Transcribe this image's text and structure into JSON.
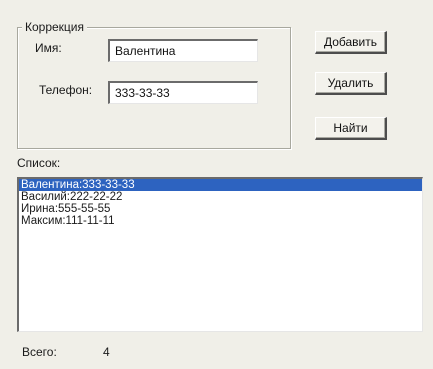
{
  "correction": {
    "title": "Коррекция",
    "name_label": "Имя:",
    "name_value": "Валентина",
    "phone_label": "Телефон:",
    "phone_value": "333-33-33"
  },
  "buttons": {
    "add": "Добавить",
    "delete": "Удалить",
    "find": "Найти"
  },
  "list": {
    "label": "Список:",
    "items": [
      {
        "text": "Валентина:333-33-33",
        "selected": true
      },
      {
        "text": "Василий:222-22-22",
        "selected": false
      },
      {
        "text": "Ирина:555-55-55",
        "selected": false
      },
      {
        "text": "Максим:111-11-11",
        "selected": false
      }
    ]
  },
  "total": {
    "label": "Всего:",
    "count": "4"
  },
  "colors": {
    "window_bg": "#f0efe8",
    "selection": "#2d63c0"
  }
}
